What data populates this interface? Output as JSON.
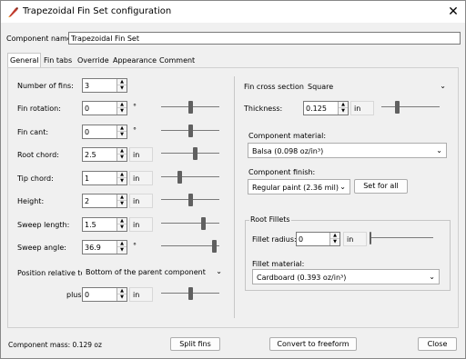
{
  "window": {
    "title": "Trapezoidal Fin Set configuration"
  },
  "component_name": {
    "label": "Component name:",
    "value": "Trapezoidal Fin Set"
  },
  "tabs": [
    {
      "label": "General",
      "active": true
    },
    {
      "label": "Fin tabs"
    },
    {
      "label": "Override"
    },
    {
      "label": "Appearance"
    },
    {
      "label": "Comment"
    }
  ],
  "left": {
    "num_fins": {
      "label": "Number of fins:",
      "value": "3"
    },
    "fin_rotation": {
      "label": "Fin rotation:",
      "value": "0",
      "unit": "°",
      "slider_fraction": 0.5
    },
    "fin_cant": {
      "label": "Fin cant:",
      "value": "0",
      "unit": "°",
      "slider_fraction": 0.5
    },
    "root_chord": {
      "label": "Root chord:",
      "value": "2.5",
      "unit": "in",
      "slider_fraction": 0.6
    },
    "tip_chord": {
      "label": "Tip chord:",
      "value": "1",
      "unit": "in",
      "slider_fraction": 0.3
    },
    "height": {
      "label": "Height:",
      "value": "2",
      "unit": "in",
      "slider_fraction": 0.5
    },
    "sweep_length": {
      "label": "Sweep length:",
      "value": "1.5",
      "unit": "in",
      "slider_fraction": 0.75
    },
    "sweep_angle": {
      "label": "Sweep angle:",
      "value": "36.9",
      "unit": "°",
      "slider_fraction": 0.95
    },
    "position": {
      "label": "Position relative to:",
      "value": "Bottom of the parent component"
    },
    "plus": {
      "label": "plus",
      "value": "0",
      "unit": "in",
      "slider_fraction": 0.5
    }
  },
  "right": {
    "cross_section": {
      "label": "Fin cross section:",
      "value": "Square"
    },
    "thickness": {
      "label": "Thickness:",
      "value": "0.125",
      "unit": "in",
      "slider_fraction": 0.25
    },
    "material": {
      "label": "Component material:",
      "value": "Balsa (0.098 oz/in³)"
    },
    "finish": {
      "label": "Component finish:",
      "value": "Regular paint (2.36 mil)",
      "set_for_all": "Set for all"
    },
    "root_fillets": {
      "title": "Root Fillets",
      "radius": {
        "label": "Fillet radius:",
        "value": "0",
        "unit": "in"
      },
      "material": {
        "label": "Fillet material:",
        "value": "Cardboard (0.393 oz/in³)"
      }
    }
  },
  "footer": {
    "mass": "Component mass: 0.129 oz",
    "split_fins": "Split fins",
    "convert": "Convert to freeform",
    "close": "Close"
  }
}
